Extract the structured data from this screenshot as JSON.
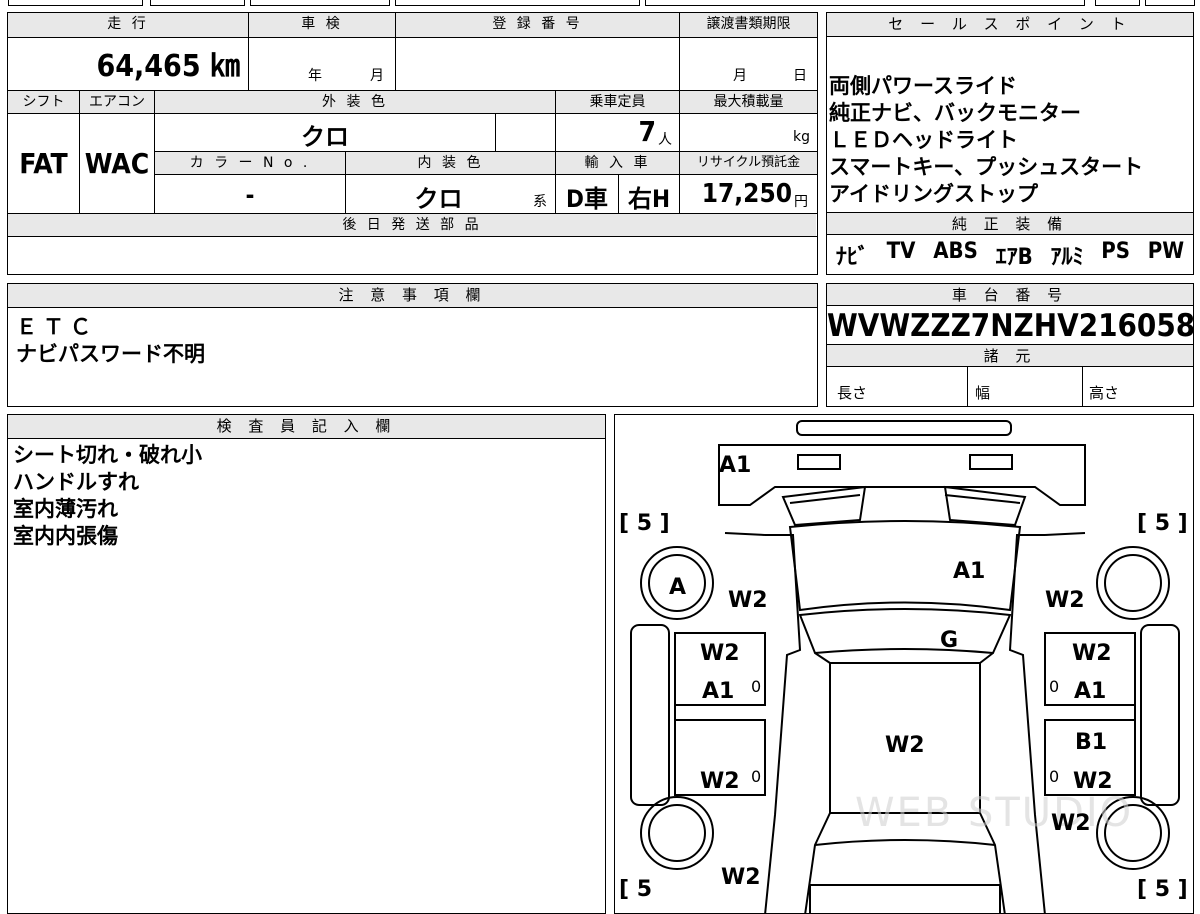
{
  "top_strip": {
    "fragment": ""
  },
  "vehicle": {
    "mileage_header": "走 行",
    "mileage_value": "64,465 ㎞",
    "inspection_header": "車 検",
    "inspection_year_unit": "年",
    "inspection_month_unit": "月",
    "registration_header": "登 録 番 号",
    "transfer_header": "譲渡書類期限",
    "transfer_month_unit": "月",
    "transfer_day_unit": "日",
    "shift_header": "シフト",
    "shift_value": "FAT",
    "ac_header": "エアコン",
    "ac_value": "WAC",
    "exterior_header": "外 装 色",
    "exterior_value": "クロ",
    "capacity_header": "乗車定員",
    "capacity_value": "7",
    "capacity_unit": "人",
    "load_header": "最大積載量",
    "load_unit": "kg",
    "color_no_header": "カ ラ ー N o .",
    "color_no_value": "-",
    "interior_header": "内 装 色",
    "interior_value": "クロ",
    "interior_suffix": "系",
    "import_header": "輸 入 車",
    "import_value_1": "D車",
    "import_value_2": "右H",
    "recycle_header": "リサイクル預託金",
    "recycle_value": "17,250",
    "recycle_unit": "円",
    "later_parts_header": "後 日 発 送 部 品"
  },
  "sales_points": {
    "header": "セ ー ル ス ポ イ ン ト",
    "items": [
      "両側パワースライド",
      "純正ナビ、バックモニター",
      "ＬＥＤヘッドライト",
      "スマートキー、プッシュスタート",
      "アイドリングストップ"
    ]
  },
  "equipment": {
    "header": "純 正 装 備",
    "items": [
      "ﾅﾋﾞ",
      "TV",
      "ABS",
      "ｴｱB",
      "ｱﾙﾐ",
      "PS",
      "PW"
    ]
  },
  "notes": {
    "header": "注 意 事 項 欄",
    "lines": [
      "ＥＴＣ",
      "ナビパスワード不明"
    ]
  },
  "chassis": {
    "header": "車 台 番 号",
    "value": "WVWZZZ7NZHV216058",
    "spec_header": "諸 元",
    "length_label": "長さ",
    "width_label": "幅",
    "height_label": "高さ"
  },
  "inspector": {
    "header": "検 査 員 記 入 欄",
    "lines": [
      "シート切れ・破れ小",
      "ハンドルすれ",
      "室内薄汚れ",
      "室内内張傷"
    ]
  },
  "diagram": {
    "watermark": "WEB STUDIO",
    "tire_tl": "[ 5 ]",
    "tire_tr": "[ 5 ]",
    "tire_bl": "[ 5",
    "tire_br": "[ 5 ]",
    "front_bumper": "A1",
    "windshield": "A1",
    "glass": "G",
    "wheel_a": "A",
    "fender_l": "W2",
    "fender_r": "W2",
    "door_fl_1": "W2",
    "door_fl_2": "A1",
    "door_fr_1": "W2",
    "door_fr_2": "A1",
    "roof": "W2",
    "door_rl": "W2",
    "door_rr_1": "B1",
    "door_rr_2": "W2",
    "quarter_r": "W2",
    "quarter_l": "W2",
    "zero": "0"
  }
}
